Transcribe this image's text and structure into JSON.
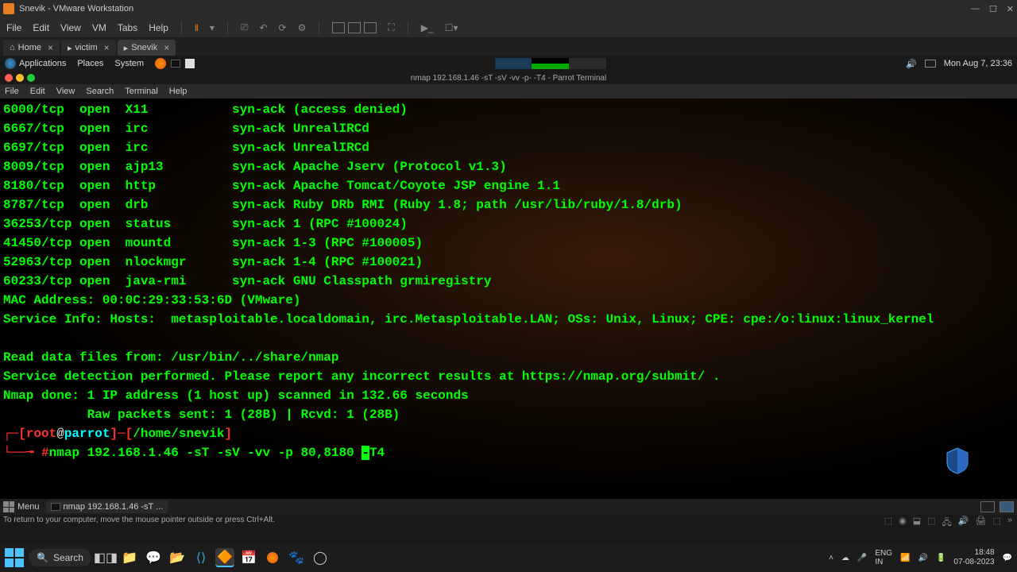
{
  "vmware": {
    "title": "Snevik - VMware Workstation",
    "menu": [
      "File",
      "Edit",
      "View",
      "VM",
      "Tabs",
      "Help"
    ],
    "tabs": [
      {
        "label": "Home",
        "active": false
      },
      {
        "label": "victim",
        "active": false
      },
      {
        "label": "Snevik",
        "active": true
      }
    ],
    "hint": "To return to your computer, move the mouse pointer outside or press Ctrl+Alt."
  },
  "guest_panel": {
    "items": [
      "Applications",
      "Places",
      "System"
    ],
    "clock": "Mon Aug 7, 23:36"
  },
  "terminal": {
    "window_title": "nmap 192.168.1.46 -sT -sV -vv -p- -T4 - Parrot Terminal",
    "menu": [
      "File",
      "Edit",
      "View",
      "Search",
      "Terminal",
      "Help"
    ],
    "ports": [
      {
        "port": "6000/tcp ",
        "state": "open  ",
        "service": "X11          ",
        "reason": "syn-ack (access denied)"
      },
      {
        "port": "6667/tcp ",
        "state": "open  ",
        "service": "irc          ",
        "reason": "syn-ack UnrealIRCd"
      },
      {
        "port": "6697/tcp ",
        "state": "open  ",
        "service": "irc          ",
        "reason": "syn-ack UnrealIRCd"
      },
      {
        "port": "8009/tcp ",
        "state": "open  ",
        "service": "ajp13        ",
        "reason": "syn-ack Apache Jserv (Protocol v1.3)"
      },
      {
        "port": "8180/tcp ",
        "state": "open  ",
        "service": "http         ",
        "reason": "syn-ack Apache Tomcat/Coyote JSP engine 1.1"
      },
      {
        "port": "8787/tcp ",
        "state": "open  ",
        "service": "drb          ",
        "reason": "syn-ack Ruby DRb RMI (Ruby 1.8; path /usr/lib/ruby/1.8/drb)"
      },
      {
        "port": "36253/tcp",
        "state": "open  ",
        "service": "status       ",
        "reason": "syn-ack 1 (RPC #100024)"
      },
      {
        "port": "41450/tcp",
        "state": "open  ",
        "service": "mountd       ",
        "reason": "syn-ack 1-3 (RPC #100005)"
      },
      {
        "port": "52963/tcp",
        "state": "open  ",
        "service": "nlockmgr     ",
        "reason": "syn-ack 1-4 (RPC #100021)"
      },
      {
        "port": "60233/tcp",
        "state": "open  ",
        "service": "java-rmi     ",
        "reason": "syn-ack GNU Classpath grmiregistry"
      }
    ],
    "mac_line": "MAC Address: 00:0C:29:33:53:6D (VMware)",
    "service_info": "Service Info: Hosts:  metasploitable.localdomain, irc.Metasploitable.LAN; OSs: Unix, Linux; CPE: cpe:/o:linux:linux_kernel",
    "footer": [
      "Read data files from: /usr/bin/../share/nmap",
      "Service detection performed. Please report any incorrect results at https://nmap.org/submit/ .",
      "Nmap done: 1 IP address (1 host up) scanned in 132.66 seconds",
      "           Raw packets sent: 1 (28B) | Rcvd: 1 (28B)"
    ],
    "prompt": {
      "user_host": "root@parrot",
      "cwd": "/home/snevik",
      "hash": "#",
      "command_before": "nmap 192.168.1.46 -sT -sV -vv -p 80,8180 ",
      "cursor_char": "-",
      "command_after": "T4"
    }
  },
  "guest_taskbar": {
    "menu_label": "Menu",
    "task": "nmap 192.168.1.46 -sT ..."
  },
  "windows": {
    "search_placeholder": "Search",
    "lang1": "ENG",
    "lang2": "IN",
    "time": "18:48",
    "date": "07-08-2023"
  }
}
